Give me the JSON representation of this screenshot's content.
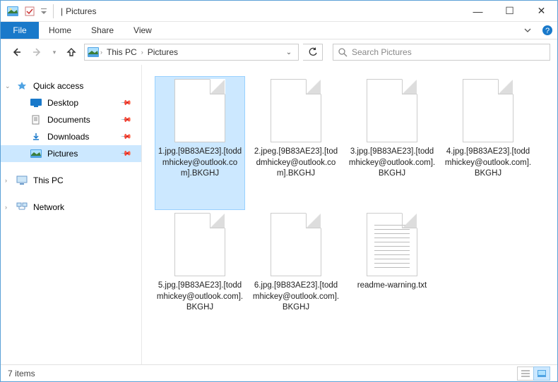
{
  "titlebar": {
    "title_sep": "|",
    "title": "Pictures"
  },
  "window_controls": {
    "minimize": "—",
    "maximize": "☐",
    "close": "✕"
  },
  "ribbon": {
    "file": "File",
    "tabs": [
      "Home",
      "Share",
      "View"
    ]
  },
  "breadcrumb": {
    "items": [
      "This PC",
      "Pictures"
    ]
  },
  "search": {
    "placeholder": "Search Pictures"
  },
  "sidebar": {
    "quick_access": "Quick access",
    "items": [
      {
        "label": "Desktop",
        "pinned": true
      },
      {
        "label": "Documents",
        "pinned": true
      },
      {
        "label": "Downloads",
        "pinned": true
      },
      {
        "label": "Pictures",
        "pinned": true,
        "selected": true
      }
    ],
    "this_pc": "This PC",
    "network": "Network"
  },
  "files": [
    {
      "name": "1.jpg.[9B83AE23].[toddmhickey@outlook.com].BKGHJ",
      "type": "file",
      "selected": true
    },
    {
      "name": "2.jpeg.[9B83AE23].[toddmhickey@outlook.com].BKGHJ",
      "type": "file"
    },
    {
      "name": "3.jpg.[9B83AE23].[toddmhickey@outlook.com].BKGHJ",
      "type": "file"
    },
    {
      "name": "4.jpg.[9B83AE23].[toddmhickey@outlook.com].BKGHJ",
      "type": "file"
    },
    {
      "name": "5.jpg.[9B83AE23].[toddmhickey@outlook.com].BKGHJ",
      "type": "file"
    },
    {
      "name": "6.jpg.[9B83AE23].[toddmhickey@outlook.com].BKGHJ",
      "type": "file"
    },
    {
      "name": "readme-warning.txt",
      "type": "txt"
    }
  ],
  "statusbar": {
    "count_text": "7 items"
  },
  "colors": {
    "accent": "#1979ca",
    "selection": "#cce8ff"
  }
}
